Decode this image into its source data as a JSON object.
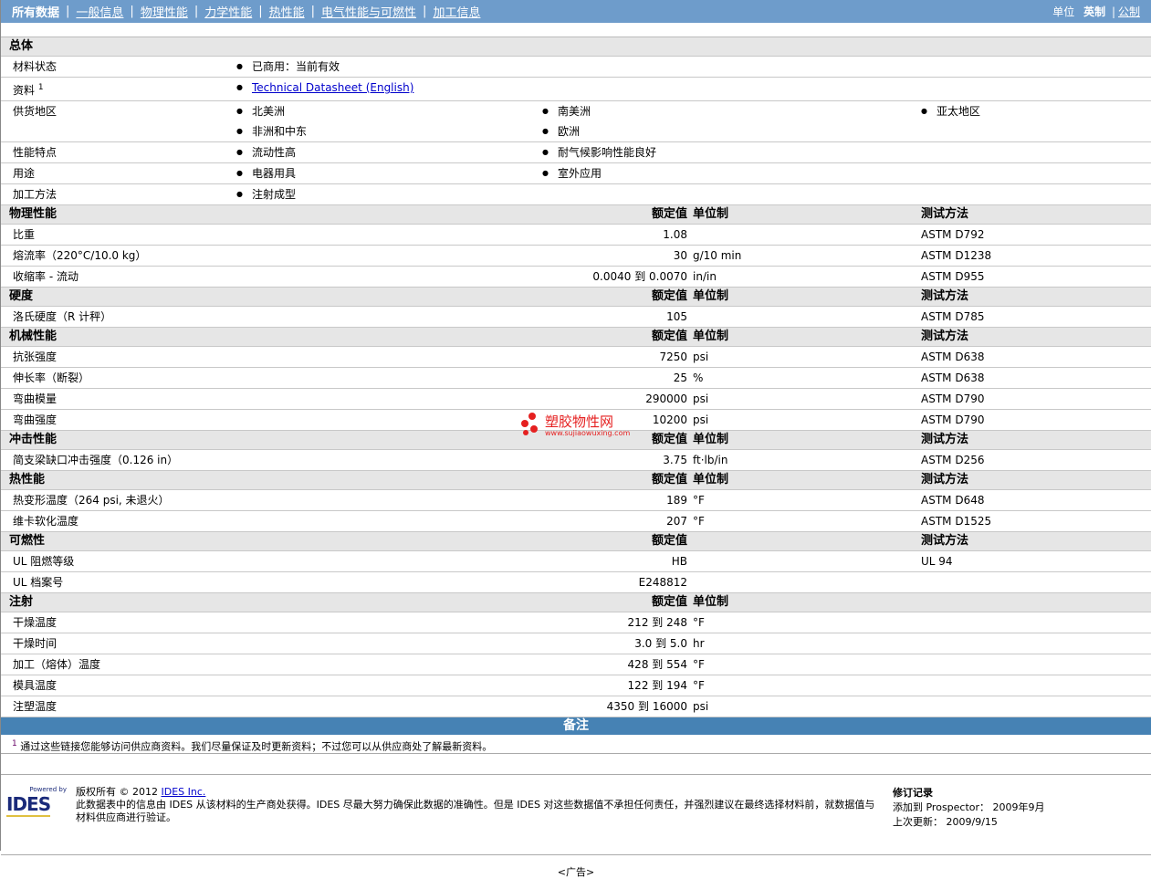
{
  "nav": {
    "active": "所有数据",
    "links": [
      "一般信息",
      "物理性能",
      "力学性能",
      "热性能",
      "电气性能与可燃性",
      "加工信息"
    ],
    "unit_label": "单位",
    "unit_active": "英制",
    "unit_other": "公制"
  },
  "general": {
    "title": "总体",
    "rows": [
      {
        "label": "材料状态",
        "items": [
          "已商用：当前有效"
        ]
      },
      {
        "label": "资料",
        "sup": "1",
        "link": "Technical Datasheet (English)"
      },
      {
        "label": "供货地区",
        "items": [
          "北美洲",
          "南美洲",
          "亚太地区",
          "非洲和中东",
          "欧洲"
        ]
      },
      {
        "label": "性能特点",
        "items": [
          "流动性高",
          "耐气候影响性能良好"
        ]
      },
      {
        "label": "用途",
        "items": [
          "电器用具",
          "室外应用"
        ]
      },
      {
        "label": "加工方法",
        "items": [
          "注射成型"
        ]
      }
    ]
  },
  "sections": [
    {
      "title": "物理性能",
      "h_value": "额定值",
      "h_unit": "单位制",
      "h_method": "测试方法",
      "rows": [
        {
          "label": "比重",
          "value": "1.08",
          "unit": "",
          "method": "ASTM D792"
        },
        {
          "label": "熔流率（220°C/10.0 kg）",
          "value": "30",
          "unit": "g/10 min",
          "method": "ASTM D1238"
        },
        {
          "label": "收缩率 - 流动",
          "value": "0.0040 到  0.0070",
          "unit": "in/in",
          "method": "ASTM D955"
        }
      ]
    },
    {
      "title": "硬度",
      "h_value": "额定值",
      "h_unit": "单位制",
      "h_method": "测试方法",
      "rows": [
        {
          "label": "洛氏硬度（R 计秤）",
          "value": "105",
          "unit": "",
          "method": "ASTM D785"
        }
      ]
    },
    {
      "title": "机械性能",
      "h_value": "额定值",
      "h_unit": "单位制",
      "h_method": "测试方法",
      "rows": [
        {
          "label": "抗张强度",
          "value": "7250",
          "unit": "psi",
          "method": "ASTM D638"
        },
        {
          "label": "伸长率（断裂）",
          "value": "25",
          "unit": "%",
          "method": "ASTM D638"
        },
        {
          "label": "弯曲模量",
          "value": "290000",
          "unit": "psi",
          "method": "ASTM D790"
        },
        {
          "label": "弯曲强度",
          "value": "10200",
          "unit": "psi",
          "method": "ASTM D790"
        }
      ]
    },
    {
      "title": "冲击性能",
      "h_value": "额定值",
      "h_unit": "单位制",
      "h_method": "测试方法",
      "rows": [
        {
          "label": "简支梁缺口冲击强度（0.126 in）",
          "value": "3.75",
          "unit": "ft·lb/in",
          "method": "ASTM D256"
        }
      ]
    },
    {
      "title": "热性能",
      "h_value": "额定值",
      "h_unit": "单位制",
      "h_method": "测试方法",
      "rows": [
        {
          "label": "热变形温度（264 psi, 未退火）",
          "value": "189",
          "unit": "°F",
          "method": "ASTM D648"
        },
        {
          "label": "维卡软化温度",
          "value": "207",
          "unit": "°F",
          "method": "ASTM D1525"
        }
      ]
    },
    {
      "title": "可燃性",
      "h_value": "额定值",
      "h_unit": "",
      "h_method": "测试方法",
      "rows": [
        {
          "label": "UL 阻燃等级",
          "value": "HB",
          "unit": "",
          "method": "UL 94"
        },
        {
          "label": "UL 档案号",
          "value": "E248812",
          "unit": "",
          "method": ""
        }
      ]
    },
    {
      "title": "注射",
      "h_value": "额定值",
      "h_unit": "单位制",
      "h_method": "",
      "rows": [
        {
          "label": "干燥温度",
          "value": "212 到  248",
          "unit": "°F",
          "method": ""
        },
        {
          "label": "干燥时间",
          "value": "3.0 到  5.0",
          "unit": "hr",
          "method": ""
        },
        {
          "label": "加工（熔体）温度",
          "value": "428 到  554",
          "unit": "°F",
          "method": ""
        },
        {
          "label": "模具温度",
          "value": "122 到  194",
          "unit": "°F",
          "method": ""
        },
        {
          "label": "注塑温度",
          "value": "4350 到  16000",
          "unit": "psi",
          "method": ""
        }
      ]
    }
  ],
  "notes": {
    "title": "备注",
    "sup": "1",
    "text": "通过这些链接您能够访问供应商资料。我们尽量保证及时更新资料；不过您可以从供应商处了解最新资料。"
  },
  "footer": {
    "logo_small": "Powered by",
    "logo": "IDES",
    "copyright": "版权所有 © 2012 ",
    "company_link": "IDES Inc.",
    "disclaimer": "此数据表中的信息由 IDES 从该材料的生产商处获得。IDES 尽最大努力确保此数据的准确性。但是 IDES 对这些数据值不承担任何责任，并强烈建议在最终选择材料前，就数据值与材料供应商进行验证。",
    "rev_title": "修订记录",
    "added": "添加到 Prospector： 2009年9月",
    "updated": "上次更新： 2009/9/15",
    "ad": "<广告>"
  },
  "watermark": {
    "name": "塑胶物性网",
    "url": "www.sujiaowuxing.com",
    "color": "#e52020"
  }
}
